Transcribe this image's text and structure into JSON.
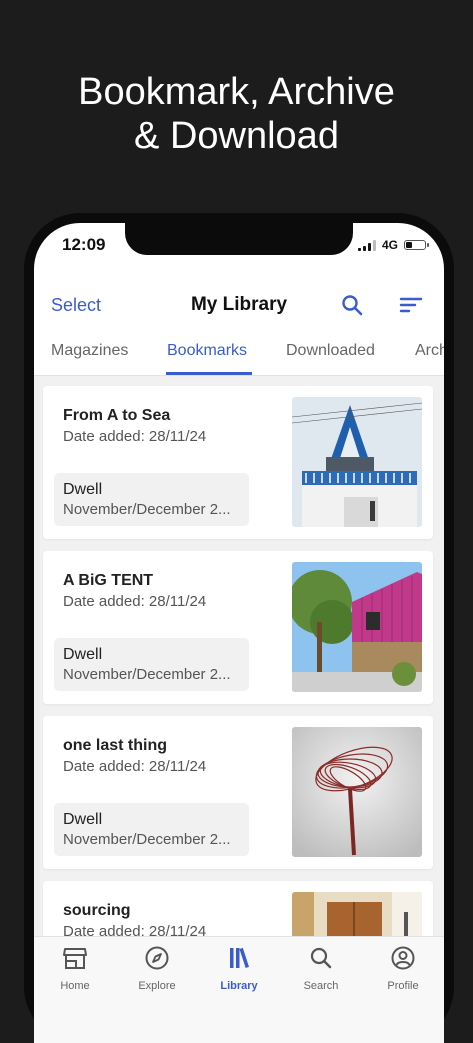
{
  "headline": {
    "line1": "Bookmark, Archive",
    "line2": "& Download"
  },
  "status": {
    "time": "12:09",
    "network": "4G"
  },
  "nav": {
    "select_label": "Select",
    "title": "My Library"
  },
  "tabs": [
    {
      "label": "Magazines"
    },
    {
      "label": "Bookmarks",
      "active": true
    },
    {
      "label": "Downloaded"
    },
    {
      "label": "Arch"
    }
  ],
  "cards": [
    {
      "title": "From A to Sea",
      "date": "Date added: 28/11/24",
      "magazine": "Dwell",
      "issue": "November/December 2...",
      "thumb": "a-frame-house-image"
    },
    {
      "title": "A BiG TENT",
      "date": "Date added: 28/11/24",
      "magazine": "Dwell",
      "issue": "November/December 2...",
      "thumb": "pink-house-image"
    },
    {
      "title": "one last thing",
      "date": "Date added: 28/11/24",
      "magazine": "Dwell",
      "issue": "November/December 2...",
      "thumb": "sculpture-image"
    },
    {
      "title": "sourcing",
      "date": "Date added: 28/11/24",
      "magazine": "",
      "issue": "",
      "thumb": "interior-image"
    }
  ],
  "tabbar": [
    {
      "label": "Home",
      "icon": "store-icon"
    },
    {
      "label": "Explore",
      "icon": "compass-icon"
    },
    {
      "label": "Library",
      "icon": "library-icon",
      "active": true
    },
    {
      "label": "Search",
      "icon": "search-icon"
    },
    {
      "label": "Profile",
      "icon": "profile-icon"
    }
  ],
  "colors": {
    "accent": "#3b5ccc",
    "background": "#1c1c1c",
    "list_bg": "#f1f1f1"
  }
}
